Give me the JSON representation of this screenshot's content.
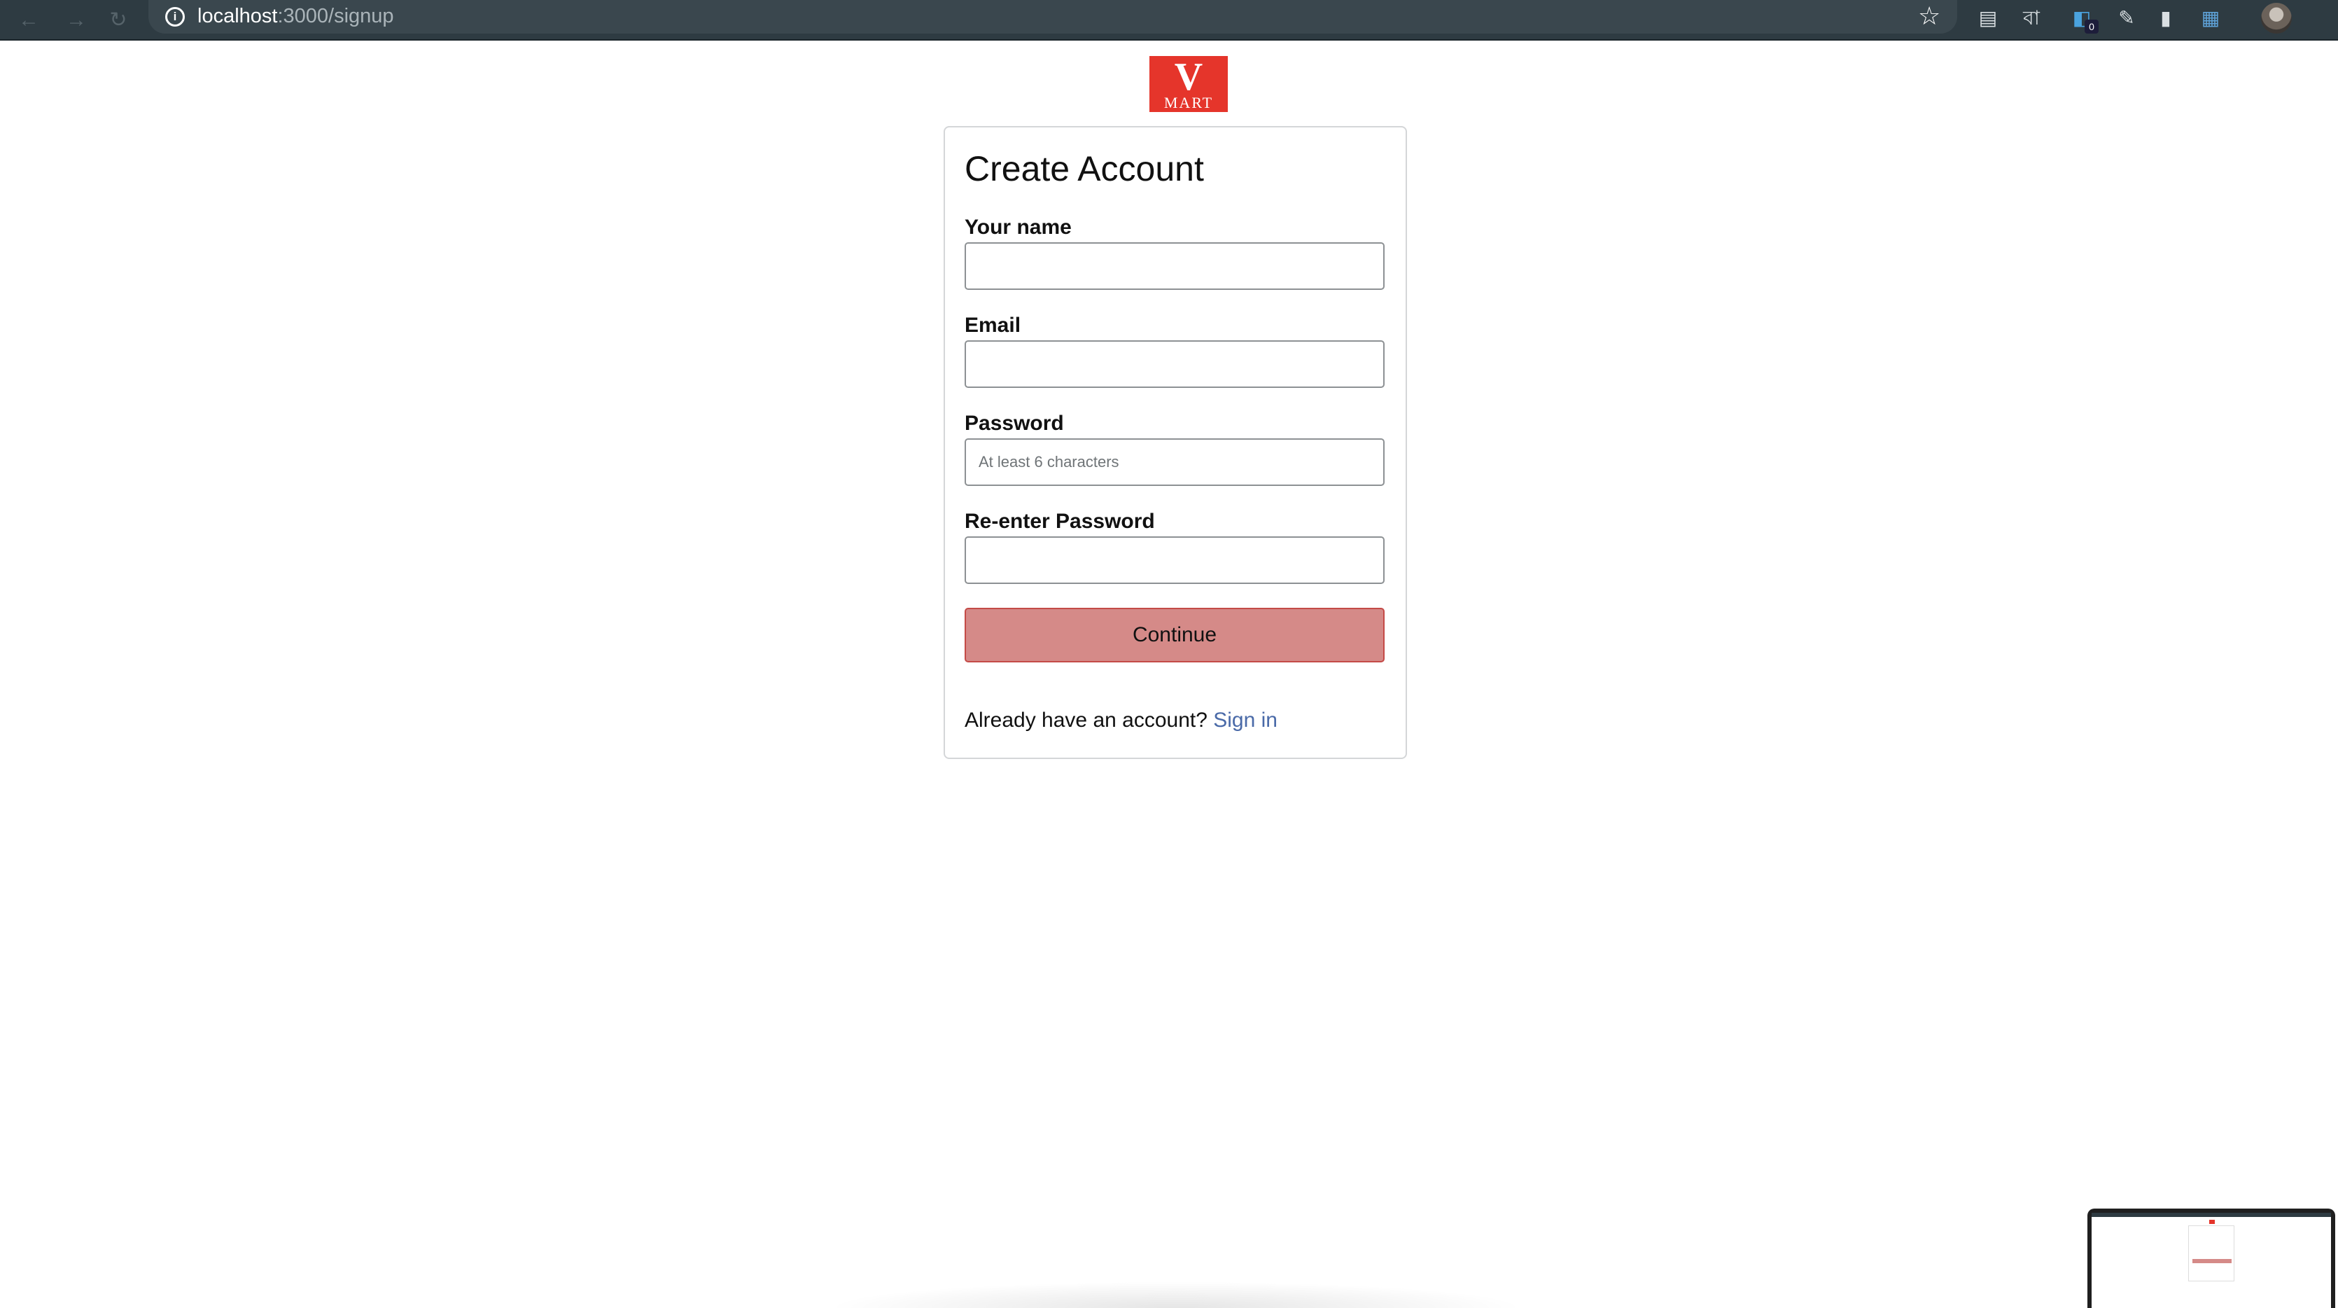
{
  "browser": {
    "url_host": "localhost",
    "url_path": ":3000/signup",
    "info_icon": "ⓘ",
    "nav": {
      "back_icon": "←",
      "forward_icon": "→",
      "reload_icon": "↻"
    },
    "extensions": [
      {
        "name": "Extension 1",
        "glyph": "▤"
      },
      {
        "name": "Extension 2",
        "glyph": "বা"
      },
      {
        "name": "Extension 3",
        "glyph": "◧",
        "badge": "0"
      },
      {
        "name": "Extension 4",
        "glyph": "✎"
      },
      {
        "name": "Extension 5",
        "glyph": "▮"
      },
      {
        "name": "Extension 6",
        "glyph": "▦"
      }
    ]
  },
  "logo": {
    "letter": "V",
    "word": "MART",
    "color": "#e5352b"
  },
  "form": {
    "title": "Create Account",
    "fields": [
      {
        "label": "Your name",
        "value": "",
        "placeholder": ""
      },
      {
        "label": "Email",
        "value": "",
        "placeholder": ""
      },
      {
        "label": "Password",
        "value": "",
        "placeholder": "At least 6 characters"
      },
      {
        "label": "Re-enter Password",
        "value": "",
        "placeholder": ""
      }
    ],
    "submit_label": "Continue",
    "signin_prompt": "Already have an account?",
    "signin_link": "Sign in"
  },
  "colors": {
    "button_fill": "#d58a88",
    "button_border": "#c44a47",
    "link": "#4a6aa8",
    "chrome_bg": "#2e3b42"
  }
}
